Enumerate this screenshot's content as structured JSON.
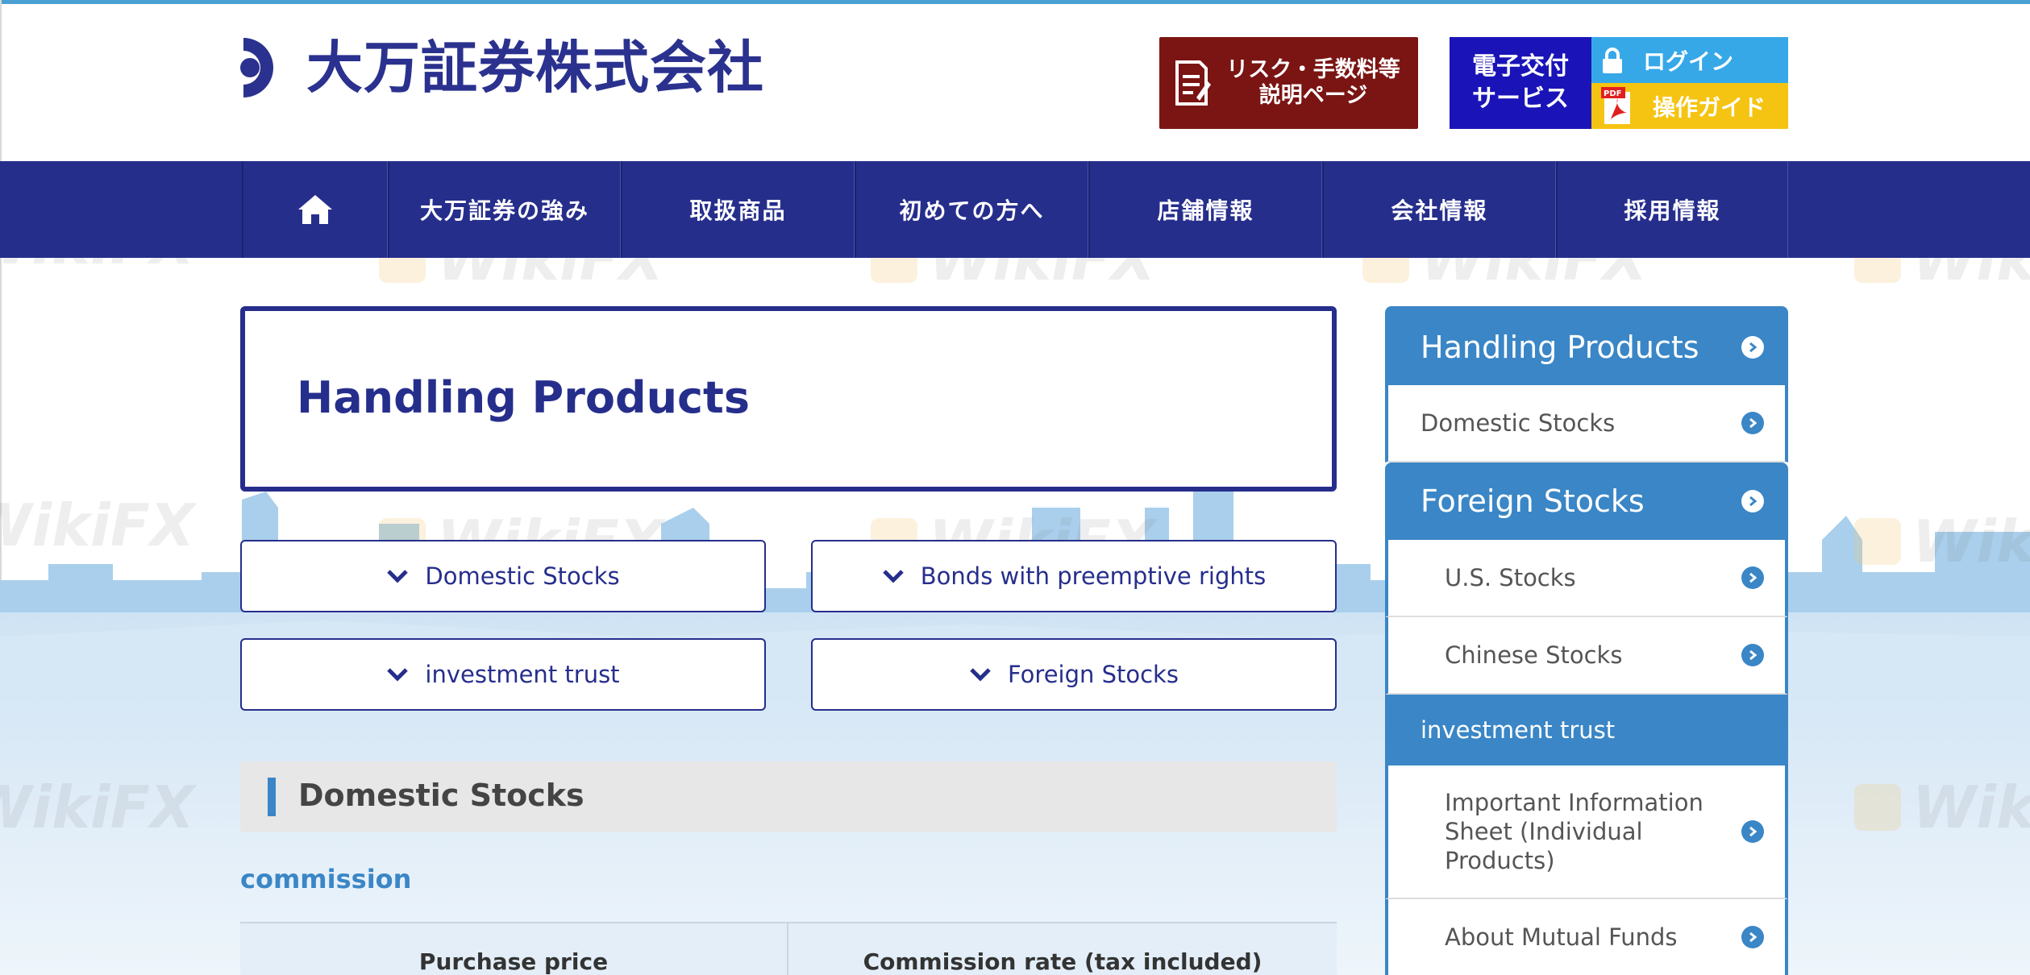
{
  "header": {
    "company_name": "大万証券株式会社",
    "risk_button_line1": "リスク・手数料等",
    "risk_button_line2": "説明ページ",
    "e_delivery_line1": "電子交付",
    "e_delivery_line2": "サービス",
    "login_label": "ログイン",
    "guide_label": "操作ガイド"
  },
  "nav": {
    "items": [
      "大万証券の強み",
      "取扱商品",
      "初めての方へ",
      "店舗情報",
      "会社情報",
      "採用情報"
    ]
  },
  "main": {
    "page_title": "Handling Products",
    "anchors": [
      "Domestic Stocks",
      "Bonds with preemptive rights",
      "investment trust",
      "Foreign Stocks"
    ],
    "section_title": "Domestic Stocks",
    "subsection_title": "commission",
    "table_headers": [
      "Purchase price",
      "Commission rate (tax included)"
    ]
  },
  "sidebar": {
    "items": [
      {
        "label": "Handling Products"
      },
      {
        "label": "Domestic Stocks"
      },
      {
        "label": "Foreign Stocks"
      },
      {
        "label": "U.S. Stocks"
      },
      {
        "label": "Chinese Stocks"
      },
      {
        "label": "investment trust"
      },
      {
        "label": "Important Information Sheet (Individual Products)"
      },
      {
        "label": "About Mutual Funds"
      }
    ]
  },
  "watermark": {
    "text": "WikiFX"
  },
  "colors": {
    "brand_navy": "#262e8c",
    "accent_blue": "#3a86c6",
    "risk_red": "#7a1513",
    "login_blue": "#36a8e8",
    "guide_yellow": "#f5c412",
    "e_delivery_blue": "#1a14b8"
  },
  "icons": {
    "home": "home-icon",
    "document": "document-icon",
    "lock": "lock-icon",
    "pdf": "pdf-icon",
    "chevron": "chevron-down-icon",
    "arrow": "arrow-circle-right-icon"
  }
}
